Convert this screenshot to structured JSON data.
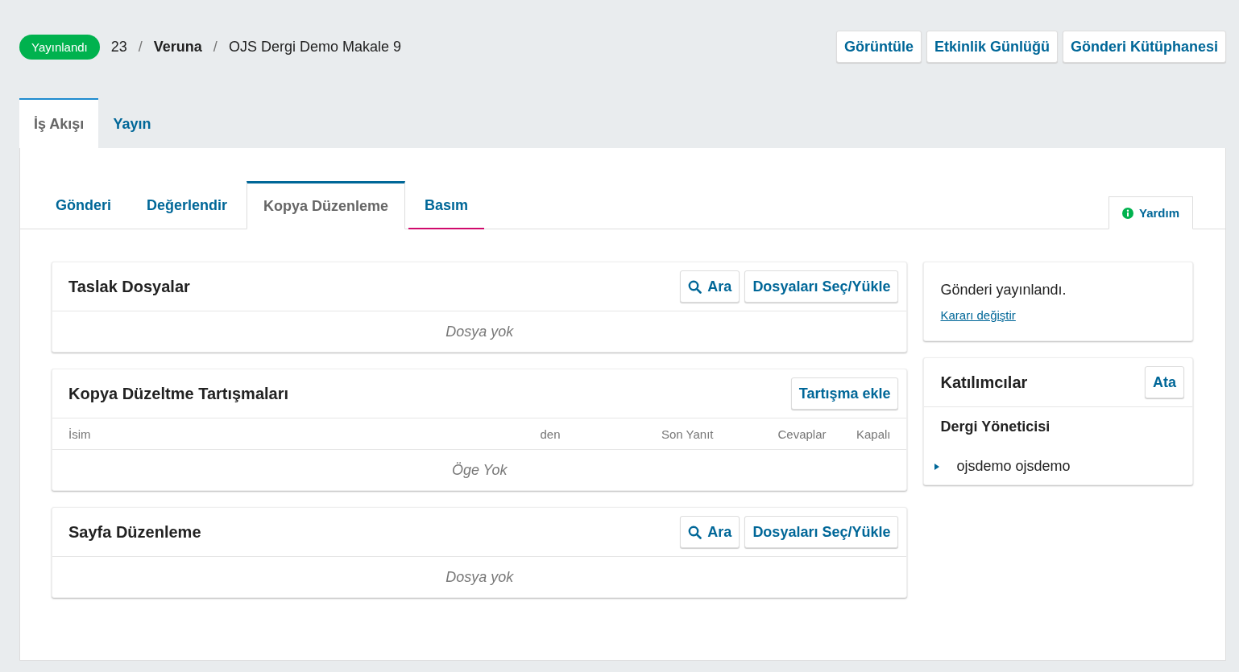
{
  "header": {
    "status": "Yayınlandı",
    "breadcrumb": [
      {
        "kind": "number",
        "text": "23"
      },
      {
        "kind": "separator",
        "text": "/"
      },
      {
        "kind": "journal",
        "text": "Veruna"
      },
      {
        "kind": "separator",
        "text": "/"
      },
      {
        "kind": "title",
        "text": "OJS Dergi Demo Makale 9"
      }
    ],
    "actions": [
      "Görüntüle",
      "Etkinlik Günlüğü",
      "Gönderi Kütüphanesi"
    ]
  },
  "tabs": [
    {
      "label": "İş Akışı",
      "selected": true
    },
    {
      "label": "Yayın",
      "selected": false
    }
  ],
  "stage_tabs": [
    {
      "label": "Gönderi",
      "selected": false,
      "focused": false
    },
    {
      "label": "Değerlendir",
      "selected": false,
      "focused": false
    },
    {
      "label": "Kopya Düzenleme",
      "selected": true,
      "focused": false
    },
    {
      "label": "Basım",
      "selected": false,
      "focused": true
    }
  ],
  "help": "Yardım",
  "panels": [
    {
      "kind": "files",
      "title": "Taslak Dosyalar",
      "buttons": [
        {
          "kind": "search",
          "label": "Ara"
        },
        {
          "kind": "plain",
          "label": "Dosyaları Seç/Yükle"
        }
      ],
      "empty": "Dosya yok"
    },
    {
      "kind": "discussions",
      "title": "Kopya Düzeltme Tartışmaları",
      "buttons": [
        {
          "kind": "plain",
          "label": "Tartışma ekle"
        }
      ],
      "columns": [
        "İsim",
        "den",
        "Son Yanıt",
        "Cevaplar",
        "Kapalı"
      ],
      "empty": "Öge Yok"
    },
    {
      "kind": "files",
      "title": "Sayfa Düzenleme",
      "buttons": [
        {
          "kind": "search",
          "label": "Ara"
        },
        {
          "kind": "plain",
          "label": "Dosyaları Seç/Yükle"
        }
      ],
      "empty": "Dosya yok"
    }
  ],
  "sidebar": {
    "decision": {
      "text": "Gönderi yayınlandı.",
      "link": "Kararı değiştir"
    },
    "participants": {
      "title": "Katılımcılar",
      "button": "Ata",
      "groups": [
        {
          "name": "Dergi Yöneticisi",
          "members": [
            {
              "name": "ojsdemo ojsdemo",
              "expanded": false
            }
          ]
        }
      ]
    }
  }
}
